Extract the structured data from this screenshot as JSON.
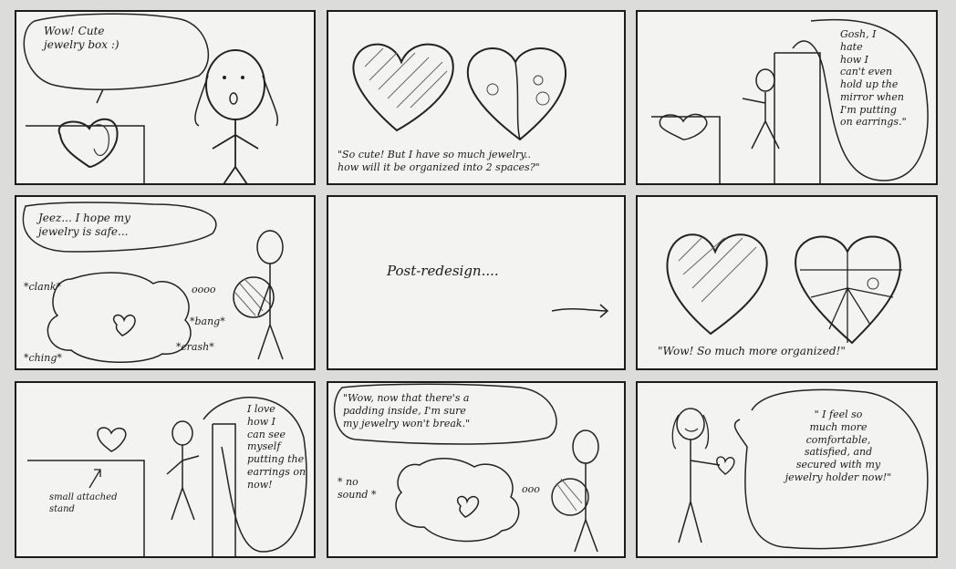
{
  "panels": [
    {
      "speech": "Wow! Cute\njewelry box :)"
    },
    {
      "speech": "\"So cute! But I have so much jewelry..\nhow will it be organized into 2 spaces?\""
    },
    {
      "speech": "Gosh, I\nhate\nhow I\ncan't even\nhold up the\nmirror when\nI'm putting\non earrings.\""
    },
    {
      "speech": "Jeez... I hope my\njewelry is safe...",
      "sfx1": "*clank*",
      "sfx2": "*bang*",
      "sfx3": "*crash*",
      "sfx4": "*ching*",
      "dots": "oooo"
    },
    {
      "caption": "Post-redesign...."
    },
    {
      "speech": "\"Wow! So much more organized!\""
    },
    {
      "speech": "I love\nhow I\ncan see\nmyself\nputting the\nearrings on\nnow!",
      "note": "small attached\nstand"
    },
    {
      "speech": "\"Wow, now that there's a\npadding inside, I'm sure\nmy jewelry won't break.\"",
      "sfx": "* no\nsound *",
      "dots": "ooo"
    },
    {
      "speech": "\" I feel so\nmuch more\ncomfortable,\nsatisfied, and\nsecured with my\njewelry holder now!\""
    }
  ]
}
